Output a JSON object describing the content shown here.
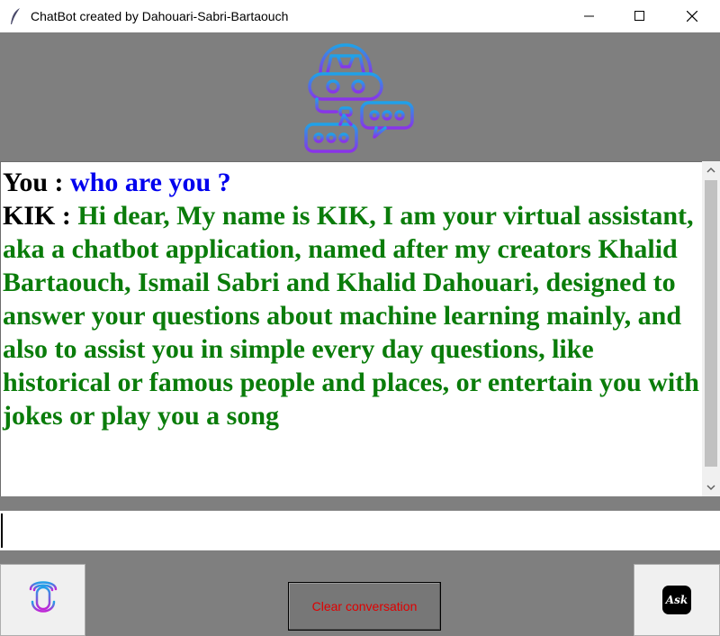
{
  "window": {
    "title": "ChatBot created by Dahouari-Sabri-Bartaouch",
    "icon": "feather-icon"
  },
  "header": {
    "logo": "robot-chat-icon"
  },
  "chat": {
    "messages": [
      {
        "speaker": "You :",
        "text": "who are you ?",
        "color": "#0000ee"
      },
      {
        "speaker": "KIK :",
        "text": "Hi dear, My name is KIK, I am your virtual assistant, aka a chatbot application, named after my creators Khalid Bartaouch, Ismail Sabri and Khalid Dahouari, designed to answer your questions about machine learning mainly, and also to assist you in simple every day questions, like historical or famous people and places, or entertain you with jokes or play you a song",
        "color": "#0a7c0a"
      }
    ]
  },
  "input": {
    "value": "",
    "placeholder": ""
  },
  "buttons": {
    "mic": "microphone-icon",
    "clear_label": "Clear conversation",
    "ask_label": "Ask",
    "ask": "ask-icon"
  },
  "colors": {
    "background": "#7f7f7f",
    "user_text": "#0000ee",
    "bot_text": "#0a7c0a",
    "clear_text": "#e00000"
  }
}
